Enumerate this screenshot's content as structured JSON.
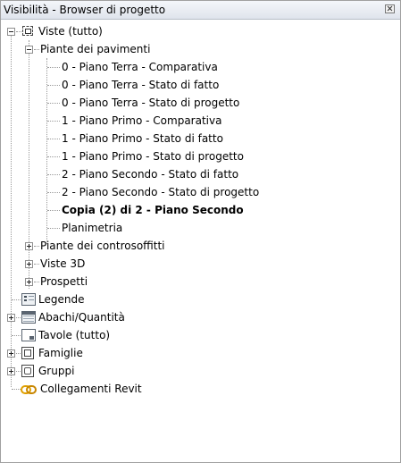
{
  "panel": {
    "title": "Visibilità - Browser di progetto"
  },
  "tree": {
    "views_root": "Viste (tutto)",
    "floor_plans": "Piante dei pavimenti",
    "floor_plan_items": [
      "0 - Piano Terra - Comparativa",
      "0 - Piano Terra - Stato di fatto",
      "0 - Piano Terra - Stato di progetto",
      "1 - Piano Primo - Comparativa",
      "1 - Piano Primo - Stato di fatto",
      "1 - Piano Primo - Stato di progetto",
      "2 - Piano Secondo - Stato di fatto",
      "2 - Piano Secondo - Stato di progetto",
      "Copia (2) di 2 - Piano Secondo",
      "Planimetria"
    ],
    "ceiling_plans": "Piante dei controsoffitti",
    "views_3d": "Viste 3D",
    "elevations": "Prospetti",
    "legends": "Legende",
    "schedules": "Abachi/Quantità",
    "sheets": "Tavole (tutto)",
    "families": "Famiglie",
    "groups": "Gruppi",
    "revit_links": "Collegamenti Revit"
  },
  "icons": {
    "views_root": "view-icon",
    "legends": "legend-icon",
    "schedules": "schedule-icon",
    "sheets": "sheet-icon",
    "families": "family-icon",
    "groups": "group-icon",
    "revit_links": "link-icon"
  },
  "colors": {
    "connector": "#9a9a9a",
    "link_icon": "#e0a000"
  }
}
